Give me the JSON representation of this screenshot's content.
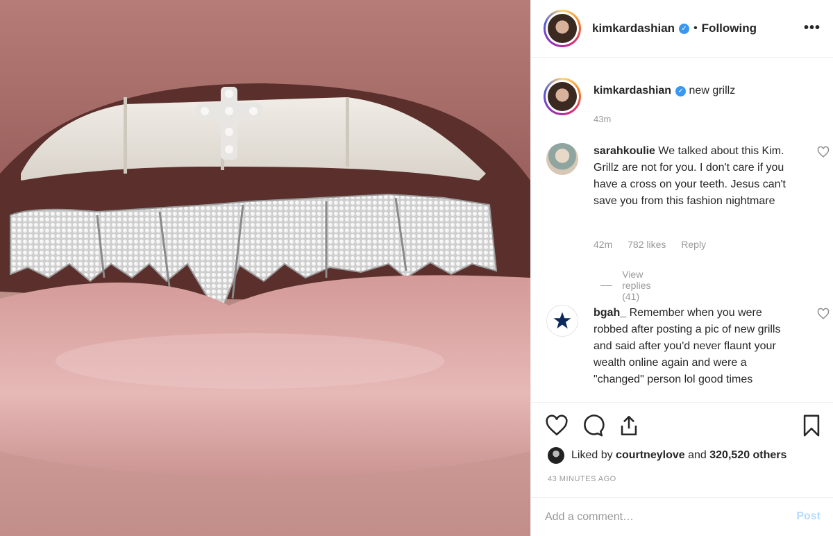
{
  "post": {
    "username": "kimkardashian",
    "separator": "•",
    "follow_status": "Following",
    "more_label": "•••"
  },
  "caption": {
    "username": "kimkardashian",
    "text": "new grillz",
    "time": "43m"
  },
  "comments": [
    {
      "username": "sarahkoulie",
      "text": "We talked about this Kim. Grillz are not for you. I don't care if you have a cross on your teeth. Jesus can't save you from this fashion nightmare",
      "time": "42m",
      "likes": "782 likes",
      "reply": "Reply",
      "view_replies": "View replies (41)"
    },
    {
      "username": "bgah_",
      "text": "Remember when you were robbed after posting a pic of new grills and said after you'd never flaunt your wealth online again and were a \"changed\" person lol good times"
    }
  ],
  "likes_bar": {
    "prefix": "Liked by",
    "user": "courtneylove",
    "middle": "and",
    "count": "320,520 others"
  },
  "timestamp": "43 MINUTES AGO",
  "add_comment": {
    "placeholder": "Add a comment…",
    "post_label": "Post"
  },
  "colors": {
    "accent": "#3897f0",
    "muted": "#999999",
    "post_disabled": "#b3dbff",
    "border": "#efefef"
  }
}
